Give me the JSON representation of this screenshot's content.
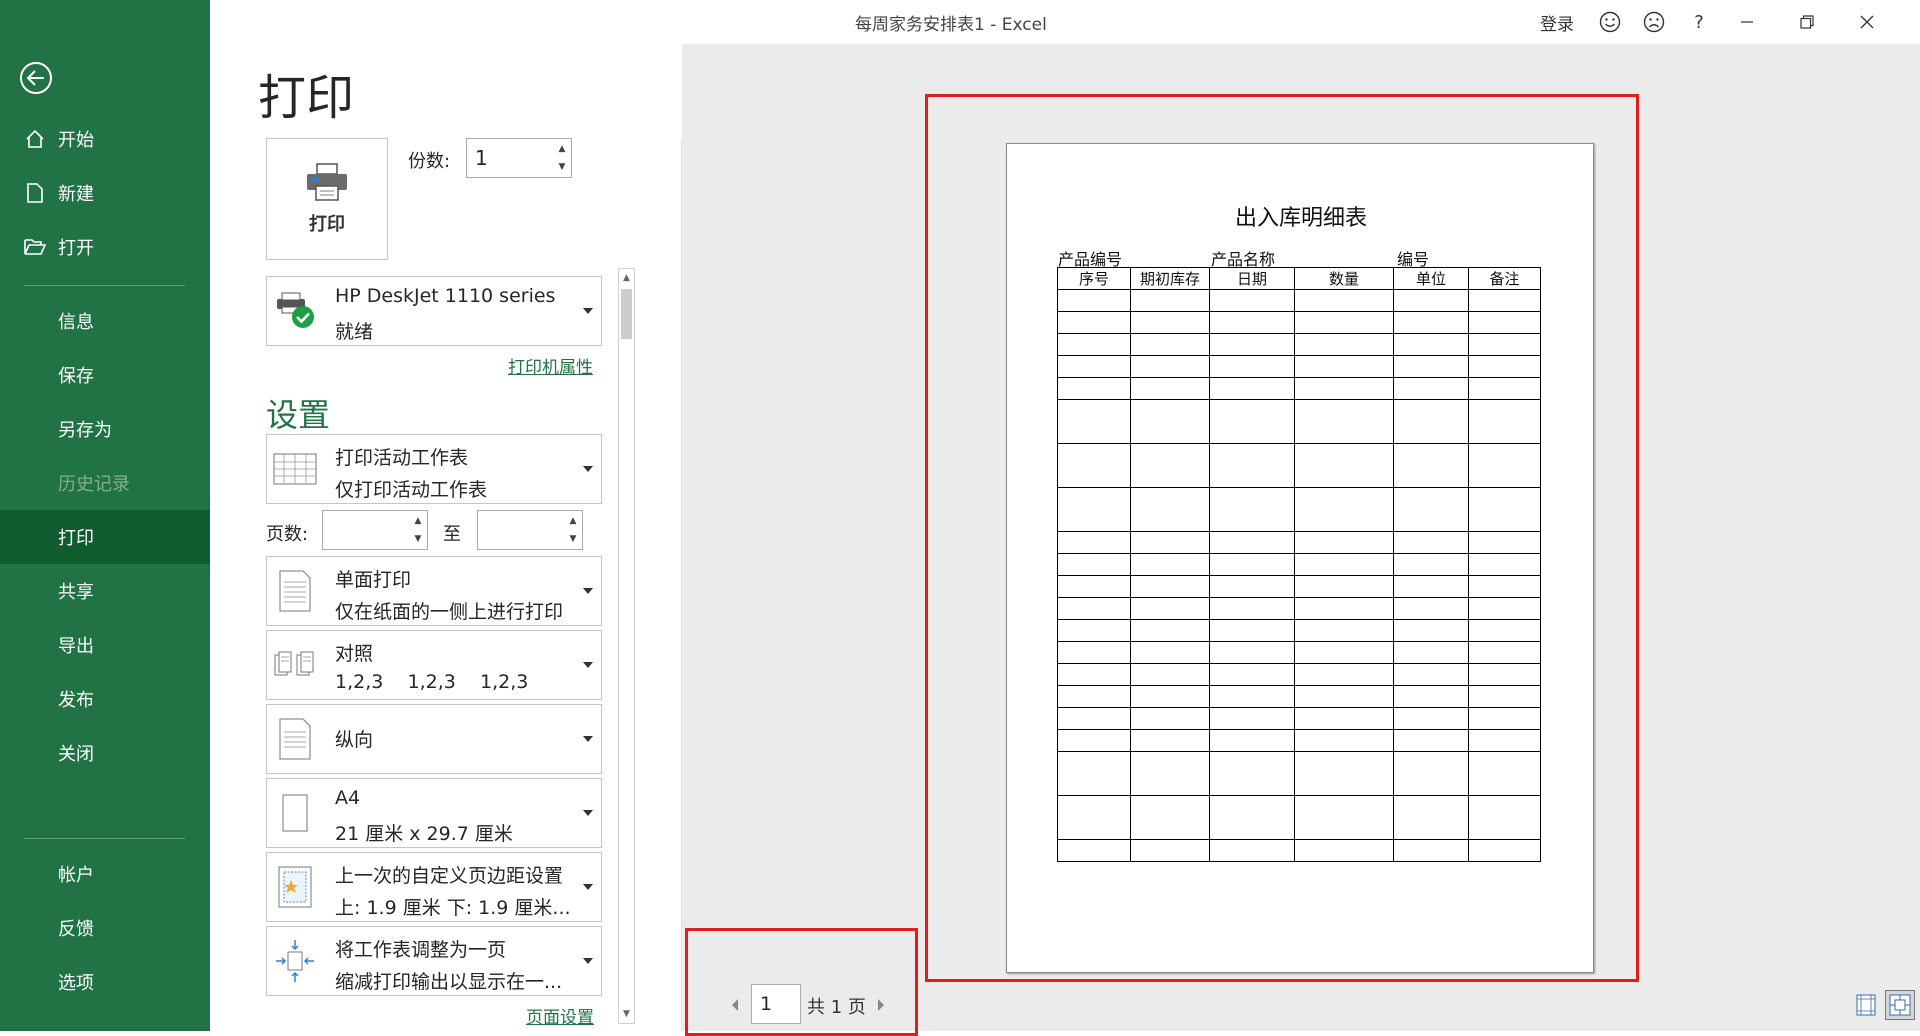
{
  "window": {
    "title": "每周家务安排表1  -  Excel",
    "signin": "登录"
  },
  "sidebar": {
    "items": [
      {
        "label": "开始",
        "icon": "home-icon"
      },
      {
        "label": "新建",
        "icon": "new-file-icon"
      },
      {
        "label": "打开",
        "icon": "folder-open-icon"
      },
      {
        "label": "信息"
      },
      {
        "label": "保存"
      },
      {
        "label": "另存为"
      },
      {
        "label": "历史记录",
        "disabled": true
      },
      {
        "label": "打印",
        "active": true
      },
      {
        "label": "共享"
      },
      {
        "label": "导出"
      },
      {
        "label": "发布"
      },
      {
        "label": "关闭"
      },
      {
        "label": "帐户"
      },
      {
        "label": "反馈"
      },
      {
        "label": "选项"
      }
    ]
  },
  "print": {
    "heading": "打印",
    "button_label": "打印",
    "copies_label": "份数:",
    "copies_value": "1",
    "printer_name": "HP DeskJet 1110 series",
    "printer_status": "就绪",
    "printer_properties_link": "打印机属性",
    "settings_heading": "设置",
    "scope_title": "打印活动工作表",
    "scope_desc": "仅打印活动工作表",
    "pages_label": "页数:",
    "pages_to_label": "至",
    "sides_title": "单面打印",
    "sides_desc": "仅在纸面的一侧上进行打印",
    "collate_title": "对照",
    "collate_desc": "1,2,3    1,2,3    1,2,3",
    "orientation": "纵向",
    "paper_title": "A4",
    "paper_desc": "21 厘米 x 29.7 厘米",
    "margins_title": "上一次的自定义页边距设置",
    "margins_desc": "上: 1.9 厘米 下: 1.9 厘米...",
    "scaling_title": "将工作表调整为一页",
    "scaling_desc": "缩减打印输出以显示在一...",
    "page_setup_link": "页面设置"
  },
  "preview": {
    "sheet_title": "出入库明细表",
    "field_product_code": "产品编号",
    "field_product_name": "产品名称",
    "field_code": "编号",
    "table_headers": [
      "序号",
      "期初库存",
      "日期",
      "数量",
      "单位",
      "备注"
    ],
    "current_page": "1",
    "total_pages": "共 1 页"
  },
  "colors": {
    "accent": "#217346",
    "active_nav": "#0e5c2f",
    "highlight": "#e01e1e"
  }
}
